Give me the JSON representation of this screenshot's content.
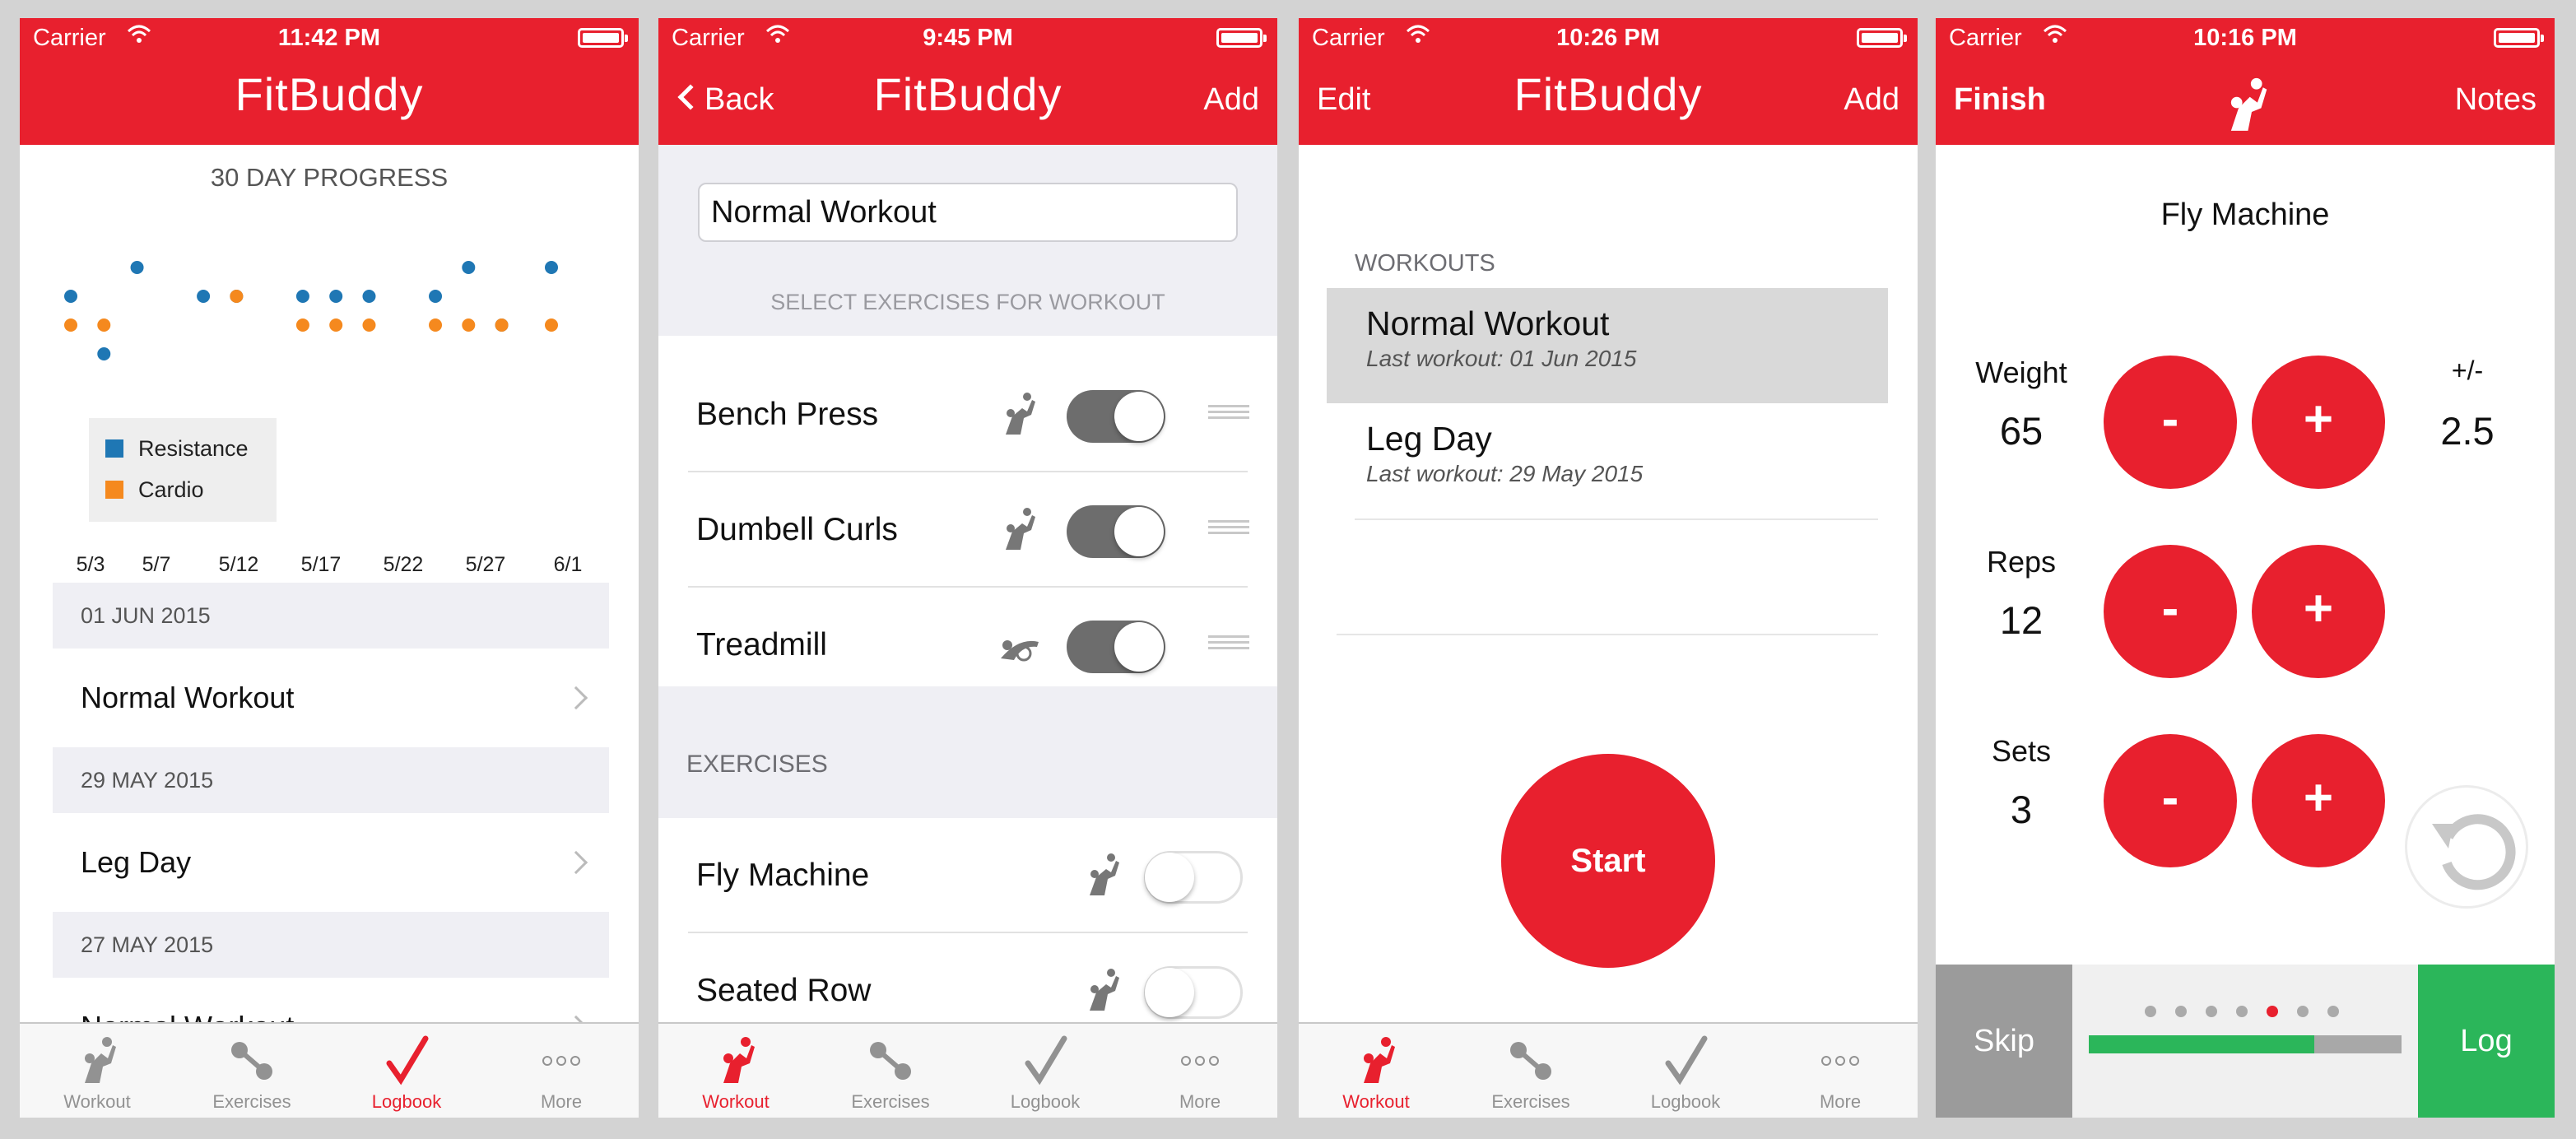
{
  "status": {
    "carrier": "Carrier",
    "times": [
      "11:42 PM",
      "9:45 PM",
      "10:26 PM",
      "10:16 PM"
    ]
  },
  "colors": {
    "brand_red": "#e8202e",
    "resistance_blue": "#1f77b4",
    "cardio_orange": "#f5891e",
    "log_green": "#2bb65a",
    "skip_grey": "#9b9b9b"
  },
  "tabs": {
    "workout": "Workout",
    "exercises": "Exercises",
    "logbook": "Logbook",
    "more": "More"
  },
  "screen1": {
    "title": "FitBuddy",
    "active_tab": "logbook",
    "chart_title": "30 DAY PROGRESS",
    "legend": {
      "resistance": "Resistance",
      "cardio": "Cardio"
    },
    "x_ticks": [
      "5/3",
      "5/7",
      "5/12",
      "5/17",
      "5/22",
      "5/27",
      "6/1"
    ],
    "log": [
      {
        "date": "01 JUN 2015",
        "workout": "Normal Workout"
      },
      {
        "date": "29 MAY 2015",
        "workout": "Leg Day"
      },
      {
        "date": "27 MAY 2015",
        "workout": "Normal Workout"
      }
    ]
  },
  "chart_data": {
    "type": "scatter",
    "title": "30 DAY PROGRESS",
    "x_ticks": [
      "5/3",
      "5/7",
      "5/12",
      "5/17",
      "5/22",
      "5/27",
      "6/1"
    ],
    "series": [
      {
        "name": "Resistance",
        "color": "#1f77b4",
        "points": [
          {
            "x": "5/3",
            "y": 2
          },
          {
            "x": "5/5",
            "y": 0
          },
          {
            "x": "5/7",
            "y": 3
          },
          {
            "x": "5/11",
            "y": 2
          },
          {
            "x": "5/13",
            "y": 2
          },
          {
            "x": "5/17",
            "y": 2
          },
          {
            "x": "5/19",
            "y": 2
          },
          {
            "x": "5/21",
            "y": 2
          },
          {
            "x": "5/25",
            "y": 2
          },
          {
            "x": "5/27",
            "y": 3
          },
          {
            "x": "5/29",
            "y": 1
          },
          {
            "x": "6/1",
            "y": 3
          }
        ]
      },
      {
        "name": "Cardio",
        "color": "#f5891e",
        "points": [
          {
            "x": "5/3",
            "y": 1
          },
          {
            "x": "5/5",
            "y": 1
          },
          {
            "x": "5/13",
            "y": 2
          },
          {
            "x": "5/17",
            "y": 1
          },
          {
            "x": "5/19",
            "y": 1
          },
          {
            "x": "5/21",
            "y": 1
          },
          {
            "x": "5/25",
            "y": 1
          },
          {
            "x": "5/27",
            "y": 1
          },
          {
            "x": "5/29",
            "y": 1
          },
          {
            "x": "6/1",
            "y": 1
          }
        ]
      }
    ],
    "legend_position": "bottom-left"
  },
  "screen2": {
    "back": "Back",
    "title": "FitBuddy",
    "add": "Add",
    "workout_name": "Normal Workout",
    "select_caption": "SELECT EXERCISES FOR WORKOUT",
    "selected": [
      {
        "name": "Bench Press",
        "icon": "resistance-icon",
        "enabled": true
      },
      {
        "name": "Dumbell Curls",
        "icon": "resistance-icon",
        "enabled": true
      },
      {
        "name": "Treadmill",
        "icon": "cardio-icon",
        "enabled": true
      }
    ],
    "exercises_header": "EXERCISES",
    "exercises": [
      {
        "name": "Fly Machine",
        "icon": "resistance-icon",
        "enabled": false
      },
      {
        "name": "Seated Row",
        "icon": "resistance-icon",
        "enabled": false
      }
    ],
    "active_tab": "workout"
  },
  "screen3": {
    "edit": "Edit",
    "title": "FitBuddy",
    "add": "Add",
    "section": "WORKOUTS",
    "workouts": [
      {
        "name": "Normal Workout",
        "last": "Last workout:  01 Jun 2015"
      },
      {
        "name": "Leg Day",
        "last": "Last workout:  29 May 2015"
      }
    ],
    "start": "Start",
    "active_tab": "workout"
  },
  "screen4": {
    "finish": "Finish",
    "notes": "Notes",
    "exercise": "Fly Machine",
    "weight_label": "Weight",
    "weight": "65",
    "increment_label": "+/-",
    "increment": "2.5",
    "reps_label": "Reps",
    "reps": "12",
    "sets_label": "Sets",
    "sets": "3",
    "minus": "-",
    "plus": "+",
    "skip": "Skip",
    "log": "Log",
    "page_count": 7,
    "current_page": 5,
    "progress": 0.72
  }
}
